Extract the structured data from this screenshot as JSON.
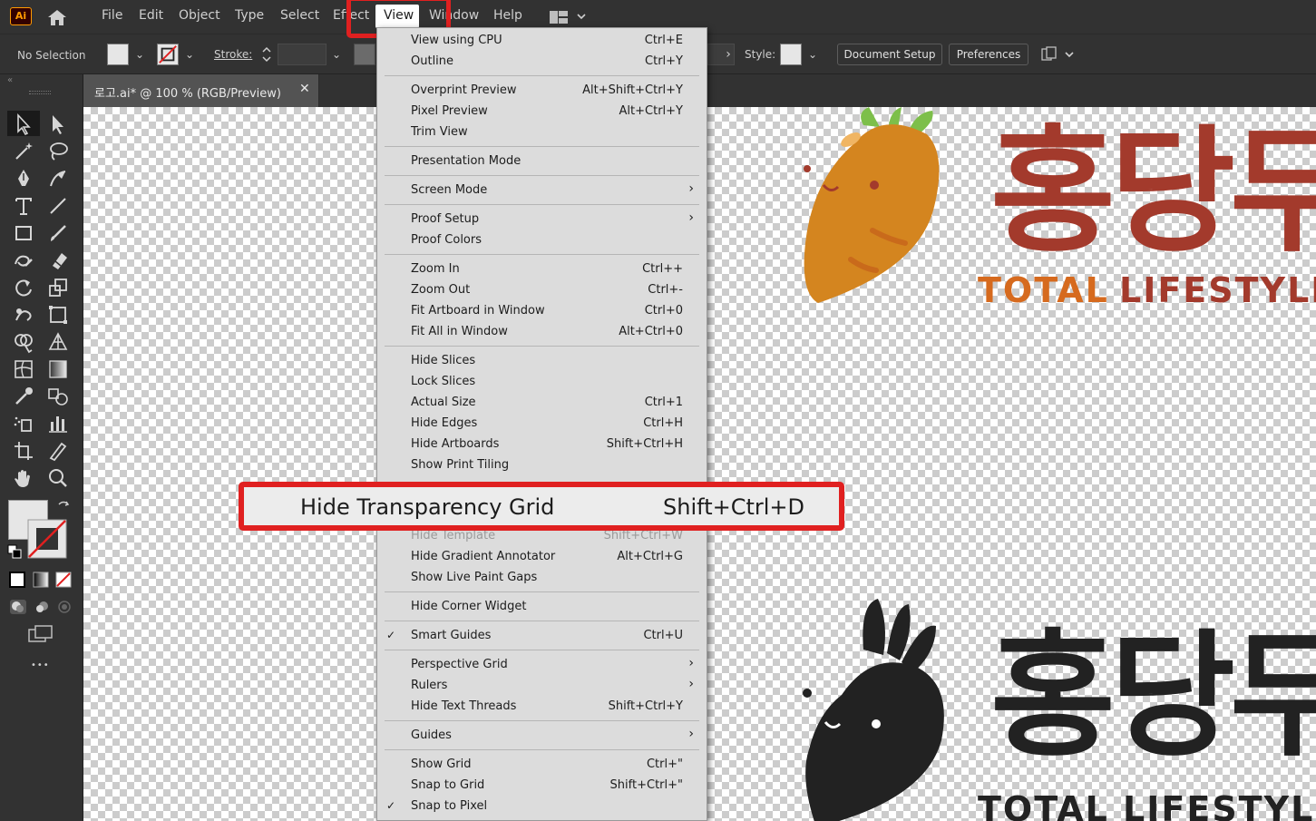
{
  "app": {
    "logo_text": "Ai"
  },
  "menubar": {
    "items": [
      "File",
      "Edit",
      "Object",
      "Type",
      "Select",
      "Effect",
      "View",
      "Window",
      "Help"
    ]
  },
  "control_bar": {
    "selection_label": "No Selection",
    "stroke_label": "Stroke:",
    "style_label": "Style:",
    "document_setup_label": "Document Setup",
    "preferences_label": "Preferences"
  },
  "document_tab": {
    "title": "로고.ai* @ 100 % (RGB/Preview)",
    "close_glyph": "✕"
  },
  "view_menu": {
    "items": [
      {
        "label": "View using CPU",
        "shortcut": "Ctrl+E"
      },
      {
        "label": "Outline",
        "shortcut": "Ctrl+Y"
      },
      {
        "label": "Overprint Preview",
        "shortcut": "Alt+Shift+Ctrl+Y"
      },
      {
        "label": "Pixel Preview",
        "shortcut": "Alt+Ctrl+Y"
      },
      {
        "label": "Trim View",
        "shortcut": ""
      },
      {
        "label": "Presentation Mode",
        "shortcut": ""
      },
      {
        "label": "Screen Mode",
        "shortcut": "",
        "submenu": true
      },
      {
        "label": "Proof Setup",
        "shortcut": "",
        "submenu": true
      },
      {
        "label": "Proof Colors",
        "shortcut": ""
      },
      {
        "label": "Zoom In",
        "shortcut": "Ctrl++"
      },
      {
        "label": "Zoom Out",
        "shortcut": "Ctrl+-"
      },
      {
        "label": "Fit Artboard in Window",
        "shortcut": "Ctrl+0"
      },
      {
        "label": "Fit All in Window",
        "shortcut": "Alt+Ctrl+0"
      },
      {
        "label": "Hide Slices",
        "shortcut": ""
      },
      {
        "label": "Lock Slices",
        "shortcut": ""
      },
      {
        "label": "Actual Size",
        "shortcut": "Ctrl+1"
      },
      {
        "label": "Hide Edges",
        "shortcut": "Ctrl+H"
      },
      {
        "label": "Hide Artboards",
        "shortcut": "Shift+Ctrl+H"
      },
      {
        "label": "Show Print Tiling",
        "shortcut": ""
      },
      {
        "label": "Hide Template",
        "shortcut": "Shift+Ctrl+W",
        "disabled": true
      },
      {
        "label": "Hide Gradient Annotator",
        "shortcut": "Alt+Ctrl+G"
      },
      {
        "label": "Show Live Paint Gaps",
        "shortcut": ""
      },
      {
        "label": "Hide Corner Widget",
        "shortcut": ""
      },
      {
        "label": "Smart Guides",
        "shortcut": "Ctrl+U",
        "checked": true
      },
      {
        "label": "Perspective Grid",
        "shortcut": "",
        "submenu": true
      },
      {
        "label": "Rulers",
        "shortcut": "",
        "submenu": true
      },
      {
        "label": "Hide Text Threads",
        "shortcut": "Shift+Ctrl+Y"
      },
      {
        "label": "Guides",
        "shortcut": "",
        "submenu": true
      },
      {
        "label": "Show Grid",
        "shortcut": "Ctrl+\""
      },
      {
        "label": "Snap to Grid",
        "shortcut": "Shift+Ctrl+\""
      },
      {
        "label": "Snap to Pixel",
        "shortcut": "",
        "checked": true
      }
    ],
    "highlighted_item": {
      "label": "Hide Transparency Grid",
      "shortcut": "Shift+Ctrl+D"
    }
  },
  "canvas": {
    "logo_top": {
      "korean": "홍당무",
      "tagline_a": "TOTAL",
      "tagline_b": "LIFESTYLE"
    },
    "logo_bottom": {
      "korean": "홍당무",
      "tagline": "TOTAL LIFESTYLE"
    },
    "colors": {
      "carrot": "#d4851f",
      "brand_red": "#a33a2c",
      "leaf": "#7dbf4a",
      "tagline_orange": "#d66a1e",
      "dark": "#222222"
    }
  },
  "glyphs": {
    "check": "✓",
    "submenu_arrow": "›",
    "more": "•••",
    "dropdown": "⌄"
  }
}
